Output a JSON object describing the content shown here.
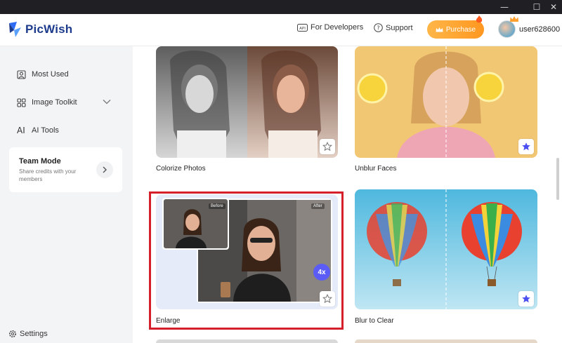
{
  "window": {
    "controls": {
      "minimize": "—",
      "maximize": "☐",
      "close": "✕"
    }
  },
  "header": {
    "app_name": "PicWish",
    "developers_label": "For Developers",
    "support_label": "Support",
    "purchase_label": "Purchase",
    "username": "user628600",
    "accent_color": "#ff9f2e",
    "brand_color": "#1d3b8c"
  },
  "sidebar": {
    "items": [
      {
        "label": "Most Used",
        "icon": "portrait-icon"
      },
      {
        "label": "Image Toolkit",
        "icon": "grid-icon"
      },
      {
        "label": "AI Tools",
        "icon": "ai-icon"
      }
    ],
    "team": {
      "title": "Team Mode",
      "description": "Share credits with your members"
    },
    "settings_label": "Settings"
  },
  "tools": [
    {
      "label": "Colorize Photos",
      "favorited": false
    },
    {
      "label": "Unblur Faces",
      "favorited": true
    },
    {
      "label": "Enlarge",
      "favorited": false,
      "before_tag": "Before",
      "after_tag": "After",
      "badge": "4x"
    },
    {
      "label": "Blur to Clear",
      "favorited": true
    }
  ]
}
